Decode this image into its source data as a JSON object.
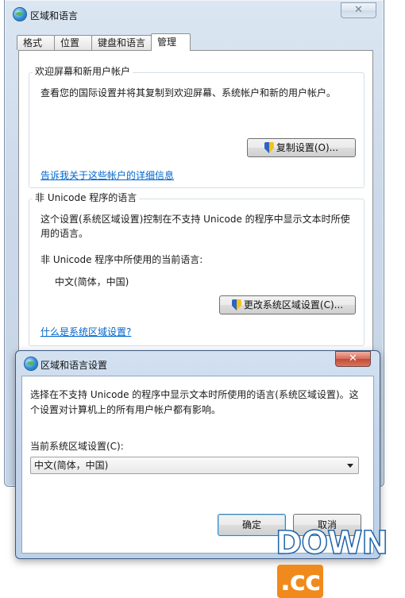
{
  "main_window": {
    "title": "区域和语言",
    "close_label": "✕",
    "tabs": [
      {
        "label": "格式"
      },
      {
        "label": "位置"
      },
      {
        "label": "键盘和语言"
      },
      {
        "label": "管理"
      }
    ],
    "active_tab": "管理",
    "welcome_group": {
      "legend": "欢迎屏幕和新用户帐户",
      "description": "查看您的国际设置并将其复制到欢迎屏幕、系统帐户和新的用户帐户。",
      "copy_button": "复制设置(O)...",
      "link": "告诉我关于这些帐户的详细信息"
    },
    "unicode_group": {
      "legend": "非 Unicode 程序的语言",
      "description_line1": "这个设置(系统区域设置)控制在不支持 Unicode 的程序中显示文本时所使",
      "description_line2": "用的语言。",
      "current_label": "非 Unicode 程序中所使用的当前语言:",
      "current_value": "中文(简体，中国)",
      "change_button": "更改系统区域设置(C)...",
      "link": "什么是系统区域设置?"
    }
  },
  "dialog": {
    "title": "区域和语言设置",
    "close_label": "✕",
    "description_line1": "选择在不支持 Unicode 的程序中显示文本时所使用的语言(系统区域设置)。这",
    "description_line2": "个设置对计算机上的所有用户帐户都有影响。",
    "select_label": "当前系统区域设置(C):",
    "select_value": "中文(简体，中国)",
    "ok_button": "确定",
    "cancel_button": "取消"
  },
  "watermark": {
    "brand": "DOWN",
    "suffix": ".cc"
  }
}
